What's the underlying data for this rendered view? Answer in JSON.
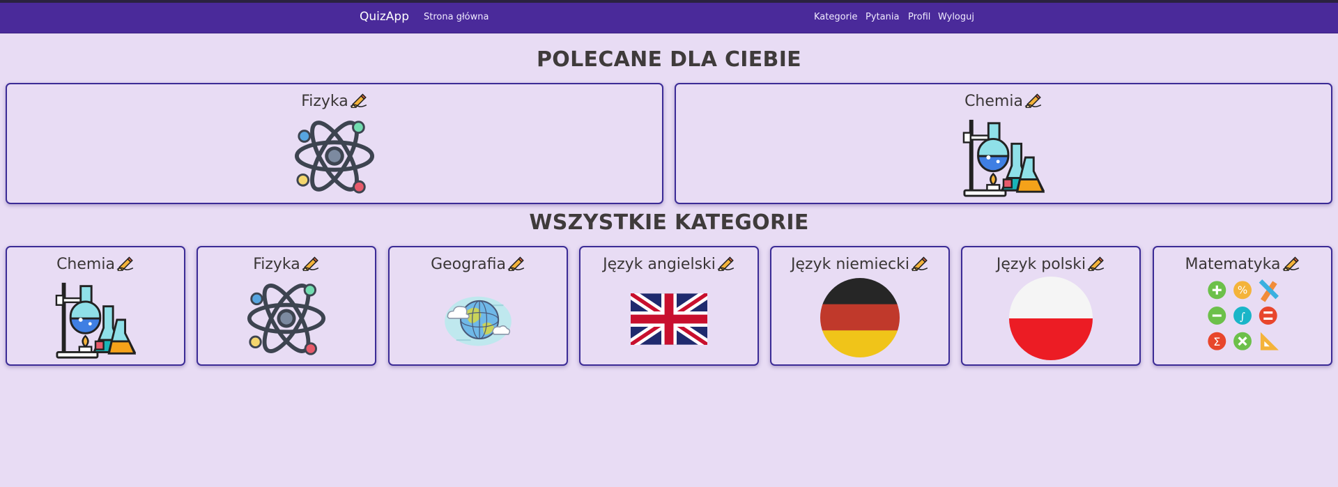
{
  "navbar": {
    "brand": "QuizApp",
    "links": [
      "Strona główna",
      "Kategorie",
      "Pytania",
      "Profil",
      "Wyloguj"
    ]
  },
  "recommended": {
    "title": "POLECANE DLA CIEBIE",
    "cards": [
      {
        "title": "Fizyka",
        "icon": "atom-icon"
      },
      {
        "title": "Chemia",
        "icon": "chemistry-lab-icon"
      }
    ]
  },
  "all": {
    "title": "WSZYSTKIE KATEGORIE",
    "cards": [
      {
        "title": "Chemia",
        "icon": "chemistry-lab-icon"
      },
      {
        "title": "Fizyka",
        "icon": "atom-icon"
      },
      {
        "title": "Geografia",
        "icon": "globe-icon"
      },
      {
        "title": "Język angielski",
        "icon": "uk-flag-icon"
      },
      {
        "title": "Język niemiecki",
        "icon": "germany-flag-icon"
      },
      {
        "title": "Język polski",
        "icon": "poland-flag-icon"
      },
      {
        "title": "Matematyka",
        "icon": "math-symbols-icon"
      }
    ]
  },
  "colors": {
    "navbar": "#4a2a9a",
    "background": "#e8dcf4",
    "card_border": "#3b2b96"
  }
}
